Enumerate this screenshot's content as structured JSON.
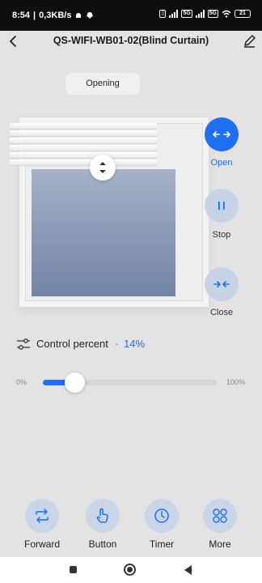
{
  "status_bar": {
    "time": "8:54",
    "network_speed": "0,3KB/s",
    "battery": "21",
    "signal_tags": [
      "5G",
      "5G"
    ]
  },
  "header": {
    "title": "QS-WIFI-WB01-02(Blind Curtain)",
    "back_icon": "chevron-left-icon",
    "edit_icon": "pencil-icon"
  },
  "status_chip": "Opening",
  "controls": {
    "open_label": "Open",
    "stop_label": "Stop",
    "close_label": "Close"
  },
  "control_percent": {
    "label": "Control percent",
    "separator": "·",
    "value_text": "14%",
    "value": 14
  },
  "slider": {
    "min_label": "0%",
    "max_label": "100%"
  },
  "features": [
    {
      "label": "Forward",
      "icon": "swap-arrows-icon"
    },
    {
      "label": "Button",
      "icon": "hand-pointer-icon"
    },
    {
      "label": "Timer",
      "icon": "clock-icon"
    },
    {
      "label": "More",
      "icon": "grid-icon"
    }
  ],
  "colors": {
    "accent": "#1f6ff2",
    "background": "#e4e3e4",
    "button_light": "#c6d3e6"
  }
}
